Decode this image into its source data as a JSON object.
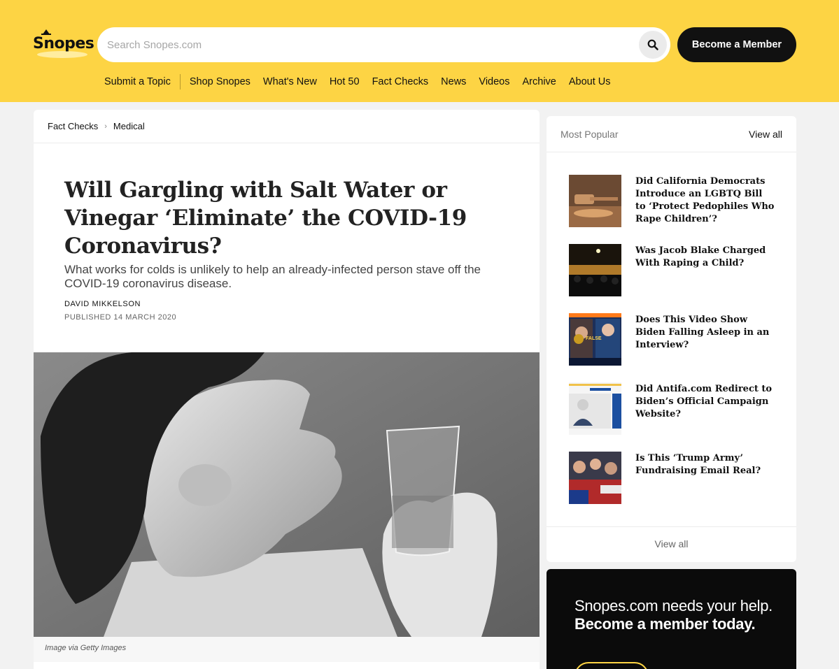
{
  "header": {
    "logo_text": "Snopes",
    "search_placeholder": "Search Snopes.com",
    "member_button": "Become a Member",
    "nav": [
      "Submit a Topic",
      "Shop Snopes",
      "What's New",
      "Hot 50",
      "Fact Checks",
      "News",
      "Videos",
      "Archive",
      "About Us"
    ]
  },
  "article": {
    "breadcrumb": [
      "Fact Checks",
      "Medical"
    ],
    "title": "Will Gargling with Salt Water or Vinegar ‘Eliminate’ the COVID-19 Coronavirus?",
    "subtitle": "What works for colds is unlikely to help an already-infected person stave off the COVID-19 coronavirus disease.",
    "author": "DAVID MIKKELSON",
    "published": "PUBLISHED 14 MARCH 2020",
    "image_caption": "Image via Getty Images"
  },
  "sidebar": {
    "popular_heading": "Most Popular",
    "view_all_top": "View all",
    "view_all_bottom": "View all",
    "items": [
      {
        "title": "Did California Democrats Introduce an LGBTQ Bill to ‘Protect Pedophiles Who Rape Children’?",
        "thumb": "gavel-thumbnail"
      },
      {
        "title": "Was Jacob Blake Charged With Raping a Child?",
        "thumb": "crowd-night-thumbnail"
      },
      {
        "title": "Does This Video Show Biden Falling Asleep in an Interview?",
        "thumb": "tv-interview-thumbnail",
        "badge": "FALSE"
      },
      {
        "title": "Did Antifa.com Redirect to Biden’s Official Campaign Website?",
        "thumb": "website-screenshot-thumbnail"
      },
      {
        "title": "Is This ‘Trump Army’ Fundraising Email Real?",
        "thumb": "rally-crowd-thumbnail"
      }
    ],
    "promo_plain": "Snopes.com needs your help. ",
    "promo_bold": "Become a member today."
  },
  "colors": {
    "brand_yellow": "#fdd444",
    "dark": "#111111",
    "page_bg": "#f2f2f2"
  }
}
